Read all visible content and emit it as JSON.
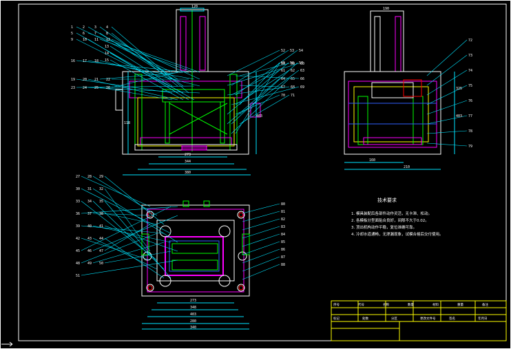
{
  "drawing": {
    "background": "#000000",
    "colors": {
      "frame": "#ffffff",
      "outline": "#ffffff",
      "leader": "#00e5ff",
      "dimension": "#00e5ff",
      "part_magenta": "#ff00ff",
      "part_green": "#00ff00",
      "part_yellow": "#ffff00",
      "part_red": "#ff2020",
      "part_blue": "#3060ff",
      "title_block": "#ffff00"
    },
    "front_view": {
      "labels_left": [
        "1",
        "2",
        "3",
        "4",
        "5",
        "6",
        "7",
        "8",
        "9",
        "10",
        "11",
        "12",
        "13",
        "14",
        "15",
        "16",
        "17",
        "18",
        "19",
        "20",
        "21",
        "22",
        "23",
        "24",
        "25",
        "26"
      ],
      "labels_right": [
        "52",
        "53",
        "54",
        "55",
        "56",
        "57",
        "58",
        "59",
        "60",
        "61",
        "62",
        "63",
        "64",
        "65",
        "66",
        "67",
        "68",
        "69",
        "70",
        "71"
      ],
      "dimensions": [
        "120",
        "273",
        "344",
        "380",
        "403",
        "118"
      ]
    },
    "side_view": {
      "labels": [
        "72",
        "73",
        "74",
        "75",
        "76",
        "77",
        "78",
        "79"
      ],
      "dimensions": [
        "190",
        "160",
        "210",
        "403",
        "325"
      ]
    },
    "plan_view": {
      "labels_left": [
        "27",
        "28",
        "29",
        "30",
        "31",
        "32",
        "33",
        "34",
        "35",
        "36",
        "37",
        "38",
        "39",
        "40",
        "41",
        "42",
        "43",
        "44",
        "45",
        "46",
        "47",
        "48",
        "49",
        "50",
        "51"
      ],
      "labels_right": [
        "80",
        "81",
        "82",
        "83",
        "84",
        "85",
        "86",
        "87",
        "88"
      ],
      "dimensions": [
        "273",
        "348",
        "403",
        "280",
        "340"
      ]
    },
    "technical_notes": {
      "heading": "技术要求",
      "items": [
        "1. 模具装配后各部件动作灵活，无卡滞、松动。",
        "2. 各模板分型面贴合良好，间隙不大于0.02。",
        "3. 顶出机构动作平稳，复位准确可靠。",
        "4. 冷却水道通畅，无渗漏现象，试模合格后交付使用。"
      ]
    },
    "title_block": {
      "row1": [
        "序号",
        "代号",
        "名称",
        "数量",
        "材料",
        "重量",
        "备注"
      ],
      "row2": [
        "标记",
        "处数",
        "分区",
        "更改文件号",
        "签名",
        "年月日"
      ]
    }
  }
}
